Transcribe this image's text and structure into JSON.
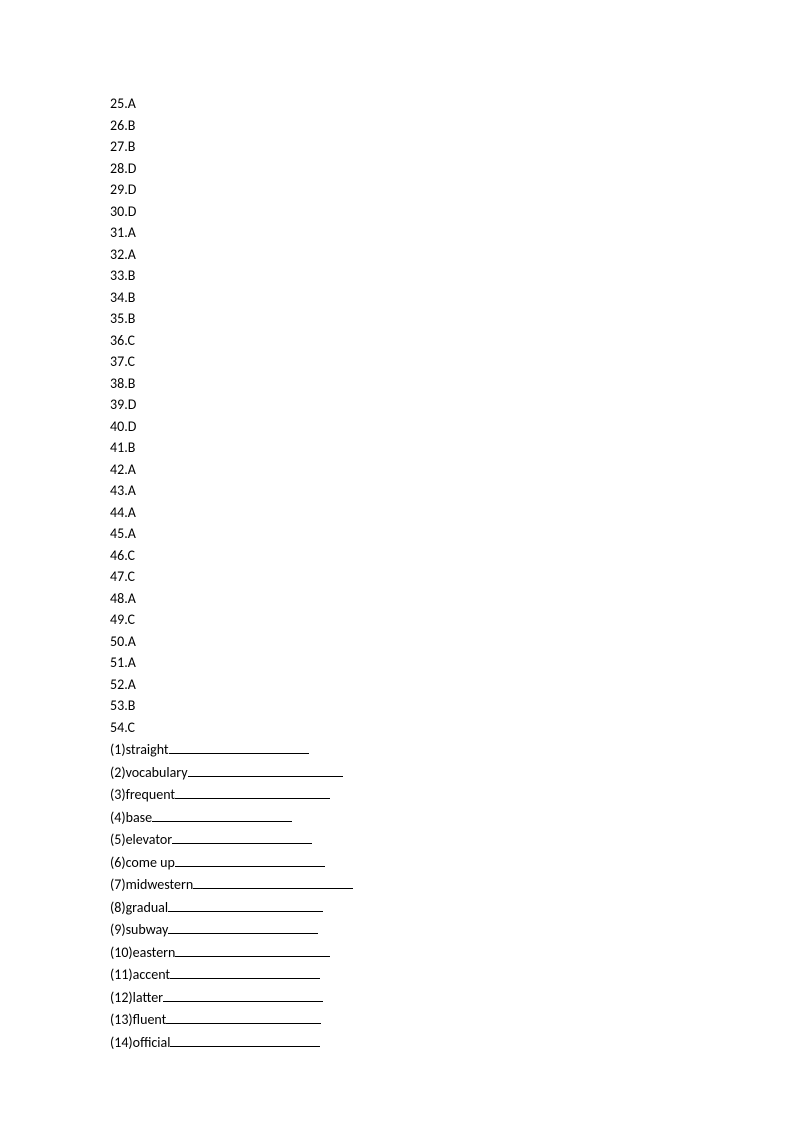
{
  "answers": [
    {
      "num": "25",
      "letter": "A"
    },
    {
      "num": "26",
      "letter": "B"
    },
    {
      "num": "27",
      "letter": "B"
    },
    {
      "num": "28",
      "letter": "D"
    },
    {
      "num": "29",
      "letter": "D"
    },
    {
      "num": "30",
      "letter": "D"
    },
    {
      "num": "31",
      "letter": "A"
    },
    {
      "num": "32",
      "letter": "A"
    },
    {
      "num": "33",
      "letter": "B"
    },
    {
      "num": "34",
      "letter": "B"
    },
    {
      "num": "35",
      "letter": "B"
    },
    {
      "num": "36",
      "letter": "C"
    },
    {
      "num": "37",
      "letter": "C"
    },
    {
      "num": "38",
      "letter": "B"
    },
    {
      "num": "39",
      "letter": "D"
    },
    {
      "num": "40",
      "letter": "D"
    },
    {
      "num": "41",
      "letter": "B"
    },
    {
      "num": "42",
      "letter": "A"
    },
    {
      "num": "43",
      "letter": "A"
    },
    {
      "num": "44",
      "letter": "A"
    },
    {
      "num": "45",
      "letter": "A"
    },
    {
      "num": "46",
      "letter": "C"
    },
    {
      "num": "47",
      "letter": "C"
    },
    {
      "num": "48",
      "letter": "A"
    },
    {
      "num": "49",
      "letter": "C"
    },
    {
      "num": "50",
      "letter": "A"
    },
    {
      "num": "51",
      "letter": "A"
    },
    {
      "num": "52",
      "letter": "A"
    },
    {
      "num": "53",
      "letter": "B"
    },
    {
      "num": "54",
      "letter": "C"
    }
  ],
  "blanks": [
    {
      "num": "1",
      "word": "straight",
      "underline_width": 140
    },
    {
      "num": "2",
      "word": "vocabulary",
      "underline_width": 155
    },
    {
      "num": "3",
      "word": "frequent",
      "underline_width": 155
    },
    {
      "num": "4",
      "word": "base",
      "underline_width": 140
    },
    {
      "num": "5",
      "word": "elevator",
      "underline_width": 140
    },
    {
      "num": "6",
      "word": "come up",
      "underline_width": 150
    },
    {
      "num": "7",
      "word": "midwestern",
      "underline_width": 160
    },
    {
      "num": "8",
      "word": "gradual",
      "underline_width": 155
    },
    {
      "num": "9",
      "word": "subway",
      "underline_width": 150
    },
    {
      "num": "10",
      "word": "eastern",
      "underline_width": 155
    },
    {
      "num": "11",
      "word": "accent",
      "underline_width": 150
    },
    {
      "num": "12",
      "word": "latter",
      "underline_width": 160
    },
    {
      "num": "13",
      "word": "fluent",
      "underline_width": 155
    },
    {
      "num": "14",
      "word": "official",
      "underline_width": 150
    }
  ]
}
